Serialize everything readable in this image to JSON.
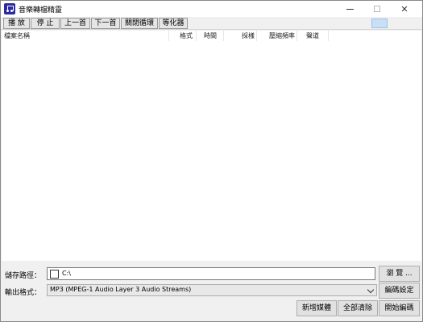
{
  "window": {
    "title": "音樂轉檔精靈"
  },
  "toolbar": {
    "items": [
      {
        "label": "播 放"
      },
      {
        "label": "停 止"
      },
      {
        "label": "上一首"
      },
      {
        "label": "下一首"
      },
      {
        "label": "關閉循環"
      },
      {
        "label": "等化器"
      }
    ]
  },
  "list": {
    "columns": [
      {
        "label": "檔案名稱"
      },
      {
        "label": "格式"
      },
      {
        "label": "時間"
      },
      {
        "label": "採樣"
      },
      {
        "label": "壓縮頻率"
      },
      {
        "label": "聲道"
      }
    ]
  },
  "save_path": {
    "label": "儲存路徑：",
    "value": "C:\\",
    "browse_label": "瀏 覽 ..."
  },
  "output_format": {
    "label": "輸出格式：",
    "selected": "MP3  (MPEG-1 Audio Layer 3 Audio Streams)",
    "settings_label": "編碼設定"
  },
  "actions": {
    "add_label": "新增媒體",
    "clear_label": "全部清除",
    "start_label": "開始編碼"
  }
}
